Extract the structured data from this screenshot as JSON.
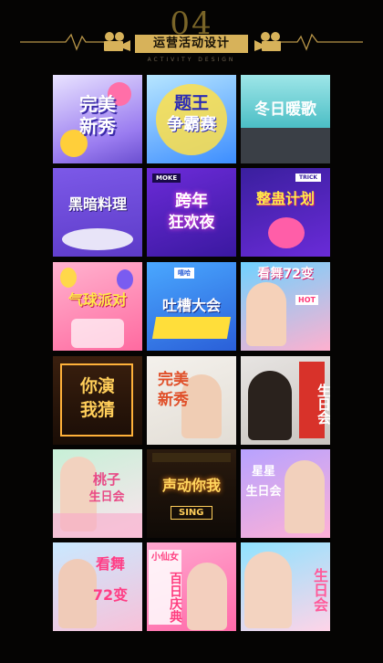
{
  "header": {
    "number": "04",
    "title": "运营活动设计",
    "subtitle": "ACTIVITY DESIGN"
  },
  "colors": {
    "gold": "#d7b25a",
    "background": "#050403"
  },
  "tiles": [
    {
      "line1": "完美",
      "line2": "新秀"
    },
    {
      "line1": "题王",
      "line2": "争霸赛"
    },
    {
      "line1": "冬日暖歌",
      "line2": ""
    },
    {
      "line1": "黑暗料理",
      "line2": ""
    },
    {
      "line1": "跨年",
      "line2": "狂欢夜",
      "badge": "MOKE"
    },
    {
      "line1": "整蛊计划",
      "line2": "",
      "badge": "TRICK"
    },
    {
      "line1": "气球派对",
      "line2": ""
    },
    {
      "line1": "吐槽大会",
      "line2": "",
      "badge": "嘻哈"
    },
    {
      "line1": "看舞72变",
      "line2": "",
      "badge": "HOT"
    },
    {
      "line1": "你演",
      "line2": "我猜"
    },
    {
      "line1": "完美",
      "line2": "新秀"
    },
    {
      "line1": "生日会",
      "line2": ""
    },
    {
      "line1": "桃子",
      "line2": "生日会"
    },
    {
      "line1": "声动你我",
      "line2": "",
      "badge": "SING"
    },
    {
      "line1": "星星",
      "line2": "生日会"
    },
    {
      "line1": "看舞",
      "line2": "72变"
    },
    {
      "line1": "小仙女",
      "line2": "百日庆典"
    },
    {
      "line1": "生日会",
      "line2": ""
    }
  ]
}
